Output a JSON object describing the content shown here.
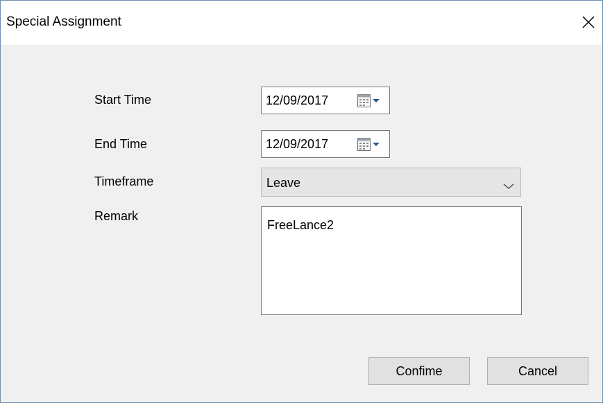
{
  "dialog": {
    "title": "Special Assignment",
    "close_icon": "close-icon"
  },
  "form": {
    "start_time": {
      "label": "Start Time",
      "value": "12/09/2017",
      "icon": "calendar-dropdown-icon"
    },
    "end_time": {
      "label": "End Time",
      "value": "12/09/2017",
      "icon": "calendar-dropdown-icon"
    },
    "timeframe": {
      "label": "Timeframe",
      "value": "Leave",
      "icon": "chevron-down-icon"
    },
    "remark": {
      "label": "Remark",
      "value": "FreeLance2"
    }
  },
  "buttons": {
    "confirm_label": "Confime",
    "cancel_label": "Cancel"
  },
  "colors": {
    "window_bg": "#f0f0f0",
    "titlebar_bg": "#ffffff",
    "button_bg": "#e1e1e1",
    "select_bg": "#e5e5e5",
    "border": "#7a7a7a"
  }
}
